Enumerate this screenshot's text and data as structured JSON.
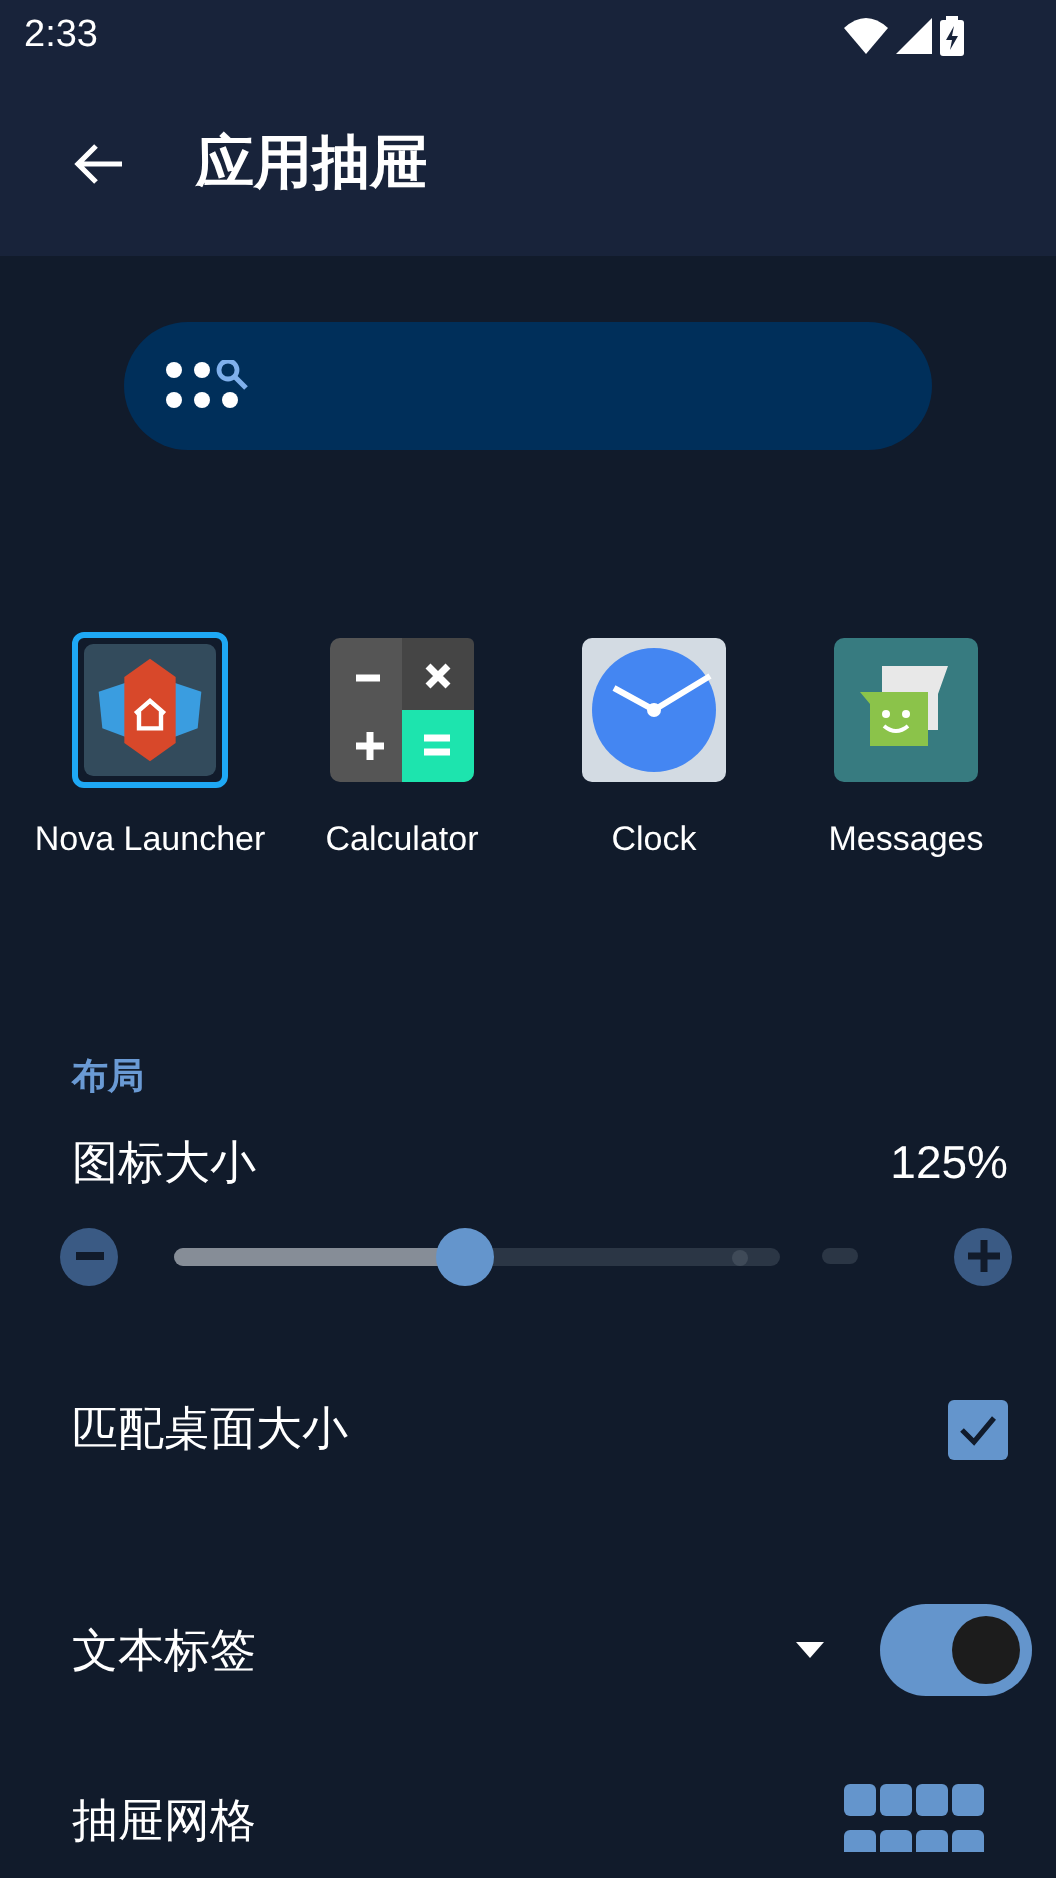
{
  "status_bar": {
    "time": "2:33"
  },
  "toolbar": {
    "title": "应用抽屉"
  },
  "apps": [
    {
      "kind": "nova",
      "name": "Nova Launcher",
      "selected": true
    },
    {
      "kind": "calculator",
      "name": "Calculator",
      "selected": false
    },
    {
      "kind": "clock",
      "name": "Clock",
      "selected": false
    },
    {
      "kind": "messages",
      "name": "Messages",
      "selected": false
    }
  ],
  "section": {
    "title": "布局"
  },
  "settings": [
    {
      "kind": "slider",
      "label": "图标大小",
      "value": "125%",
      "level": 0.48
    },
    {
      "kind": "checkbox",
      "label": "匹配桌面大小",
      "checked": true
    },
    {
      "kind": "toggle",
      "label": "文本标签",
      "on": true
    },
    {
      "kind": "grid",
      "label": "抽屉网格"
    }
  ]
}
